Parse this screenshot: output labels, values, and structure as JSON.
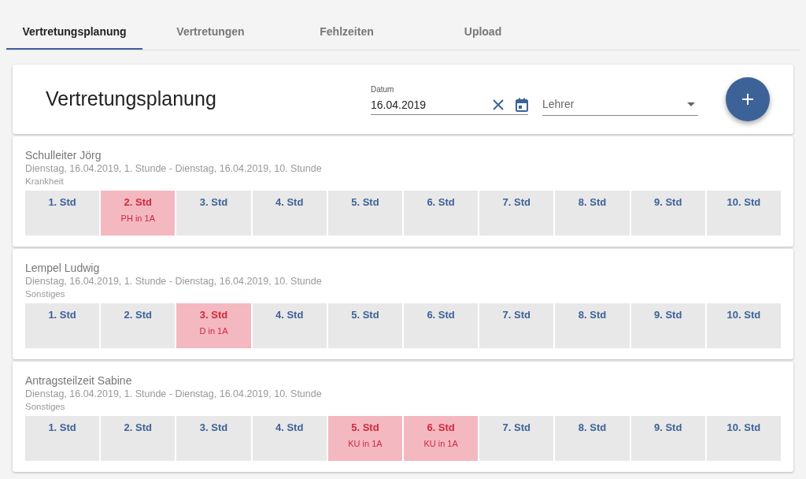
{
  "tabs": [
    {
      "label": "Vertretungsplanung",
      "selected": true
    },
    {
      "label": "Vertretungen",
      "selected": false
    },
    {
      "label": "Fehlzeiten",
      "selected": false
    },
    {
      "label": "Upload",
      "selected": false
    }
  ],
  "header": {
    "title": "Vertretungsplanung",
    "date_field": {
      "label": "Datum",
      "value": "16.04.2019"
    },
    "teacher_select": {
      "placeholder": "Lehrer"
    }
  },
  "absences": [
    {
      "name": "Schulleiter Jörg",
      "period": "Dienstag, 16.04.2019, 1. Stunde - Dienstag, 16.04.2019, 10. Stunde",
      "reason": "Krankheit",
      "slots": [
        {
          "label": "1. Std",
          "affected": false
        },
        {
          "label": "2. Std",
          "affected": true,
          "lesson": "PH in 1A"
        },
        {
          "label": "3. Std",
          "affected": false
        },
        {
          "label": "4. Std",
          "affected": false
        },
        {
          "label": "5. Std",
          "affected": false
        },
        {
          "label": "6. Std",
          "affected": false
        },
        {
          "label": "7. Std",
          "affected": false
        },
        {
          "label": "8. Std",
          "affected": false
        },
        {
          "label": "9. Std",
          "affected": false
        },
        {
          "label": "10. Std",
          "affected": false
        }
      ]
    },
    {
      "name": "Lempel Ludwig",
      "period": "Dienstag, 16.04.2019, 1. Stunde - Dienstag, 16.04.2019, 10. Stunde",
      "reason": "Sonstiges",
      "slots": [
        {
          "label": "1. Std",
          "affected": false
        },
        {
          "label": "2. Std",
          "affected": false
        },
        {
          "label": "3. Std",
          "affected": true,
          "lesson": "D in 1A"
        },
        {
          "label": "4. Std",
          "affected": false
        },
        {
          "label": "5. Std",
          "affected": false
        },
        {
          "label": "6. Std",
          "affected": false
        },
        {
          "label": "7. Std",
          "affected": false
        },
        {
          "label": "8. Std",
          "affected": false
        },
        {
          "label": "9. Std",
          "affected": false
        },
        {
          "label": "10. Std",
          "affected": false
        }
      ]
    },
    {
      "name": "Antragsteilzeit Sabine",
      "period": "Dienstag, 16.04.2019, 1. Stunde - Dienstag, 16.04.2019, 10. Stunde",
      "reason": "Sonstiges",
      "slots": [
        {
          "label": "1. Std",
          "affected": false
        },
        {
          "label": "2. Std",
          "affected": false
        },
        {
          "label": "3. Std",
          "affected": false
        },
        {
          "label": "4. Std",
          "affected": false
        },
        {
          "label": "5. Std",
          "affected": true,
          "lesson": "KU in 1A"
        },
        {
          "label": "6. Std",
          "affected": true,
          "lesson": "KU in 1A"
        },
        {
          "label": "7. Std",
          "affected": false
        },
        {
          "label": "8. Std",
          "affected": false
        },
        {
          "label": "9. Std",
          "affected": false
        },
        {
          "label": "10. Std",
          "affected": false
        }
      ]
    }
  ]
}
